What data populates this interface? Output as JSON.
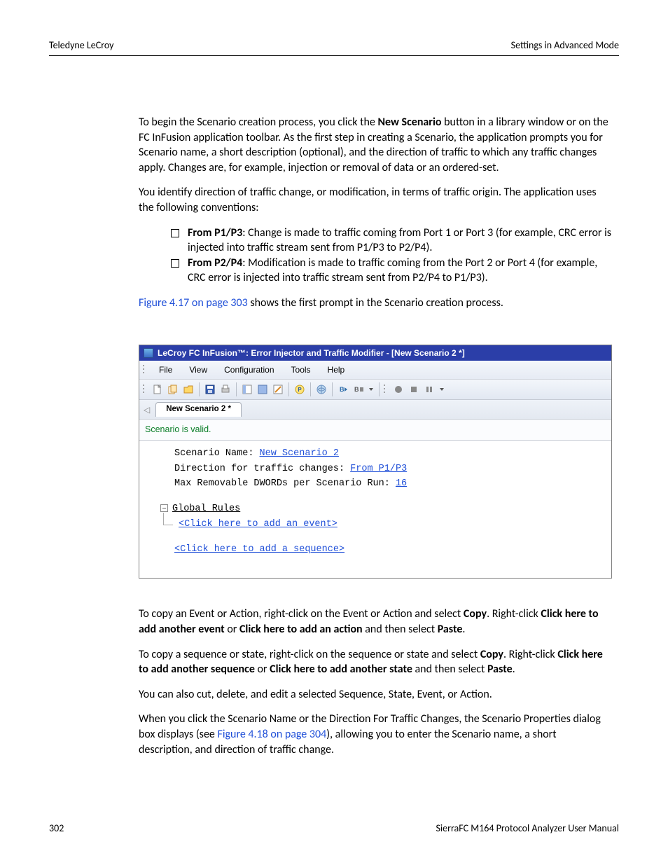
{
  "header": {
    "left": "Teledyne LeCroy",
    "right": "Settings in Advanced Mode"
  },
  "p1_a": "To begin the Scenario creation process, you click the ",
  "p1_b": "New Scenario",
  "p1_c": " button in a library window or on the FC InFusion application toolbar. As the first step in creating a Scenario, the application prompts you for Scenario name, a short description (optional), and the direction of traffic to which any traffic changes apply. Changes are, for example, injection or removal of data or an ordered-set.",
  "p2": "You identify direction of traffic change, or modification, in terms of traffic origin. The application uses the following conventions:",
  "b1_a": "From P1/P3",
  "b1_b": ": Change is made to traffic coming from Port 1 or Port 3 (for example, CRC error is injected into traffic stream sent from P1/P3 to P2/P4).",
  "b2_a": "From P2/P4",
  "b2_b": ": Modification is made to traffic coming from the Port 2 or Port 4 (for example, CRC error is injected into traffic stream sent from P2/P4 to P1/P3).",
  "p3_a": "Figure 4.17 on page 303",
  "p3_b": " shows the first prompt in the Scenario creation process.",
  "app": {
    "title": "LeCroy FC InFusion™: Error Injector and Traffic Modifier - [New Scenario 2 *]",
    "menus": {
      "file": "File",
      "view": "View",
      "config": "Configuration",
      "tools": "Tools",
      "help": "Help"
    },
    "tab": "New Scenario 2 *",
    "status": "Scenario is valid.",
    "scn_name_lbl": "Scenario Name: ",
    "scn_name_val": "New Scenario 2",
    "dir_lbl": "Direction for traffic changes: ",
    "dir_val": "From P1/P3",
    "max_lbl": "Max Removable DWORDs per Scenario Run: ",
    "max_val": "16",
    "global_rules": "Global Rules",
    "add_event": "<Click here to add an event>",
    "add_sequence": "<Click here to add a sequence>"
  },
  "p4_a": "To copy an Event or Action, right-click on the Event or Action and select ",
  "p4_b": "Copy",
  "p4_c": ". Right-click ",
  "p4_d": "Click here to add another event",
  "p4_e": " or ",
  "p4_f": "Click here to add an action",
  "p4_g": " and then select ",
  "p4_h": "Paste",
  "p4_i": ".",
  "p5_a": "To copy a sequence or state, right-click on the sequence or state and select ",
  "p5_b": "Copy",
  "p5_c": ". Right-click ",
  "p5_d": "Click here to add another sequence",
  "p5_e": " or ",
  "p5_f": "Click here to add another state",
  "p5_g": " and then select ",
  "p5_h": "Paste",
  "p5_i": ".",
  "p6": "You can also cut, delete, and edit a selected Sequence, State, Event, or Action.",
  "p7_a": "When you click the Scenario Name or the Direction For Traffic Changes, the Scenario Properties dialog box displays (see ",
  "p7_b": "Figure 4.18 on page 304",
  "p7_c": "), allowing you to enter the Scenario name, a short description, and direction of traffic change.",
  "footer": {
    "page": "302",
    "title": "SierraFC M164 Protocol Analyzer User Manual"
  }
}
